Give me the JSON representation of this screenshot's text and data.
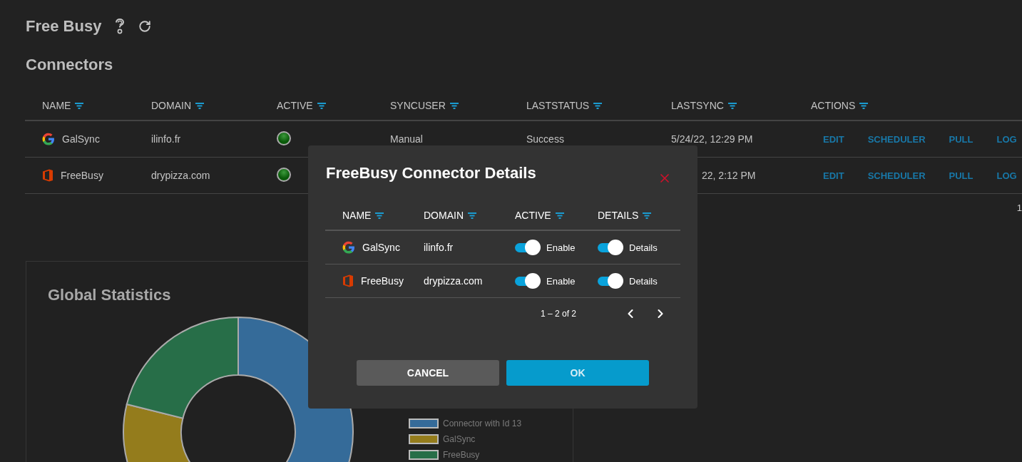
{
  "page": {
    "title": "Free Busy"
  },
  "connectors": {
    "title": "Connectors",
    "columns": [
      "NAME",
      "DOMAIN",
      "ACTIVE",
      "SYNCUSER",
      "LASTSTATUS",
      "LASTSYNC",
      "ACTIONS"
    ],
    "rows": [
      {
        "kind": "google",
        "name": "GalSync",
        "domain": "ilinfo.fr",
        "active": true,
        "syncuser": "Manual",
        "laststatus": "Success",
        "lastsync": "5/24/22, 12:29 PM",
        "covered": false,
        "actions": [
          "EDIT",
          "SCHEDULER",
          "PULL",
          "LOG"
        ]
      },
      {
        "kind": "office",
        "name": "FreeBusy",
        "domain": "drypizza.com",
        "active": true,
        "lastsync": "22, 2:12 PM",
        "covered": true,
        "actions": [
          "EDIT",
          "SCHEDULER",
          "PULL",
          "LOG"
        ]
      }
    ],
    "pagination_fragment": "1"
  },
  "statistics": {
    "title": "Global Statistics",
    "legend": [
      {
        "label": "Connector with Id 13",
        "color": "#356b99"
      },
      {
        "label": "GalSync",
        "color": "#947c1c"
      },
      {
        "label": "FreeBusy",
        "color": "#276e48"
      }
    ]
  },
  "dialog": {
    "title": "FreeBusy Connector Details",
    "columns": [
      "NAME",
      "DOMAIN",
      "ACTIVE",
      "DETAILS"
    ],
    "rows": [
      {
        "kind": "google",
        "name": "GalSync",
        "domain": "ilinfo.fr",
        "active": {
          "on": true,
          "label": "Enable"
        },
        "details": {
          "on": true,
          "label": "Details"
        }
      },
      {
        "kind": "office",
        "name": "FreeBusy",
        "domain": "drypizza.com",
        "active": {
          "on": true,
          "label": "Enable"
        },
        "details": {
          "on": true,
          "label": "Details"
        }
      }
    ],
    "range": "1 – 2 of 2",
    "buttons": [
      {
        "kind": "cancel",
        "label": "CANCEL"
      },
      {
        "kind": "ok",
        "label": "OK"
      }
    ]
  }
}
